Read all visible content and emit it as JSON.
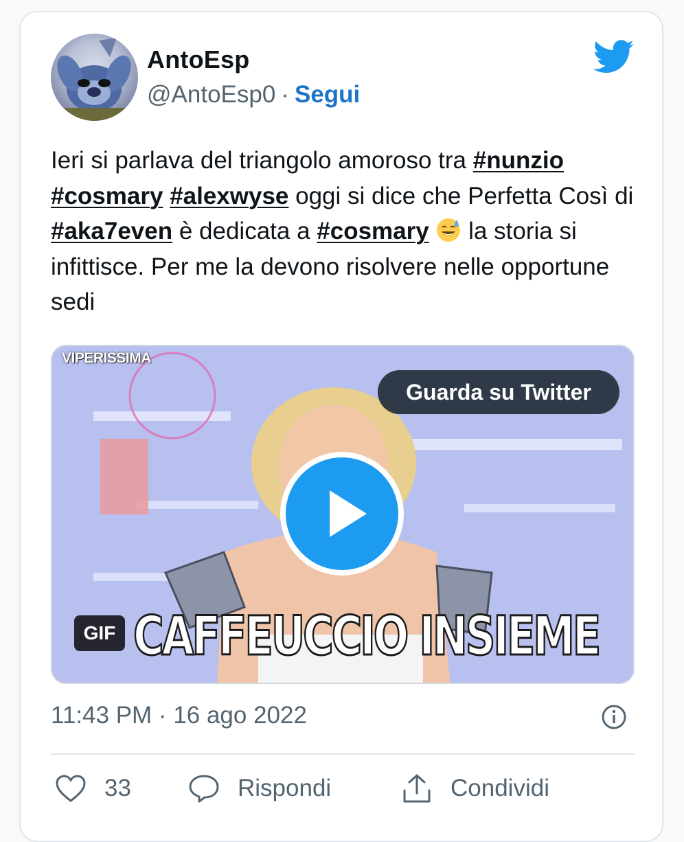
{
  "author": {
    "name": "AntoEsp",
    "handle": "@AntoEsp0",
    "separator": "·",
    "follow_label": "Segui"
  },
  "tweet": {
    "segments": [
      {
        "t": "Ieri si parlava del triangolo amoroso tra "
      },
      {
        "t": "#nunzio",
        "tag": true
      },
      {
        "t": " "
      },
      {
        "t": "#cosmary",
        "tag": true
      },
      {
        "t": " "
      },
      {
        "t": "#alexwyse",
        "tag": true
      },
      {
        "t": "  oggi si dice che Perfetta Così di "
      },
      {
        "t": "#aka7even",
        "tag": true
      },
      {
        "t": " è dedicata a "
      },
      {
        "t": "#cosmary",
        "tag": true
      },
      {
        "t": " "
      },
      {
        "emoji": "grinning-sweat-emoji"
      },
      {
        "t": " la storia si infittisce. Per me la devono risolvere nelle opportune sedi"
      }
    ]
  },
  "media": {
    "source_tag": "VIPERISSIMA",
    "watch_label": "Guarda su Twitter",
    "gif_badge": "GIF",
    "caption": "CAFFEUCCIO INSIEME"
  },
  "meta": {
    "timestamp": "11:43 PM · 16 ago 2022"
  },
  "actions": {
    "like_count": "33",
    "reply_label": "Rispondi",
    "share_label": "Condividi"
  },
  "icons": {
    "brand": "twitter-bird-icon",
    "like": "heart-icon",
    "reply": "speech-bubble-icon",
    "share": "share-upload-icon",
    "info": "info-icon",
    "play": "play-icon"
  },
  "colors": {
    "twitter_blue": "#1d9bf0",
    "link_blue": "#1d74c8",
    "muted_text": "#536471",
    "border": "#dfe5ea"
  }
}
